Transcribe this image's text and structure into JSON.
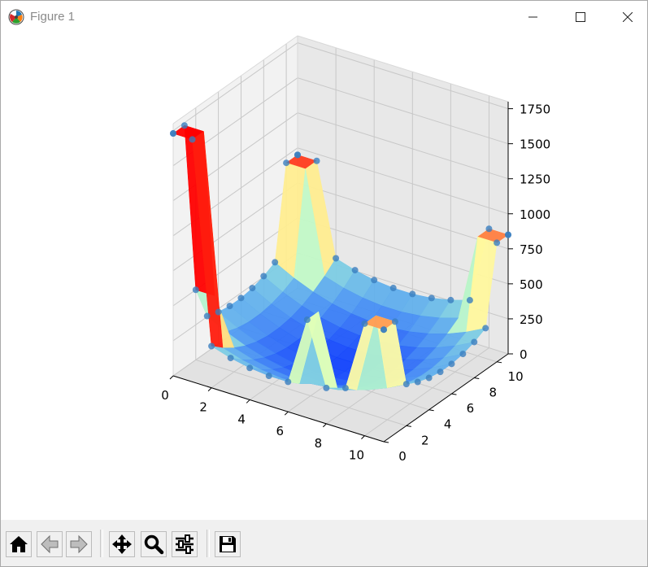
{
  "window": {
    "title": "Figure 1"
  },
  "toolbar": {
    "buttons": [
      {
        "name": "home",
        "icon": "home-icon"
      },
      {
        "name": "back",
        "icon": "arrow-left-icon"
      },
      {
        "name": "forward",
        "icon": "arrow-right-icon"
      },
      {
        "name": "pan",
        "icon": "move-icon"
      },
      {
        "name": "zoom",
        "icon": "magnifier-icon"
      },
      {
        "name": "configure-subplots",
        "icon": "sliders-icon"
      },
      {
        "name": "save",
        "icon": "floppy-disk-icon"
      }
    ]
  },
  "chart_data": {
    "type": "surface",
    "x_ticks": [
      "0",
      "2",
      "4",
      "6",
      "8",
      "10"
    ],
    "y_ticks": [
      "0",
      "2",
      "4",
      "6",
      "8",
      "10"
    ],
    "z_ticks": [
      "0",
      "250",
      "500",
      "750",
      "1000",
      "1250",
      "1500",
      "1750"
    ],
    "xlim": [
      0,
      11
    ],
    "ylim": [
      0,
      11
    ],
    "zlim": [
      0,
      1800
    ],
    "colormap": "rainbow",
    "scatter_color": "#3a7ebf",
    "pane_color": "#f2f2f2",
    "grid": true,
    "surface_min_z": 0,
    "surface_max_z": 1730
  }
}
